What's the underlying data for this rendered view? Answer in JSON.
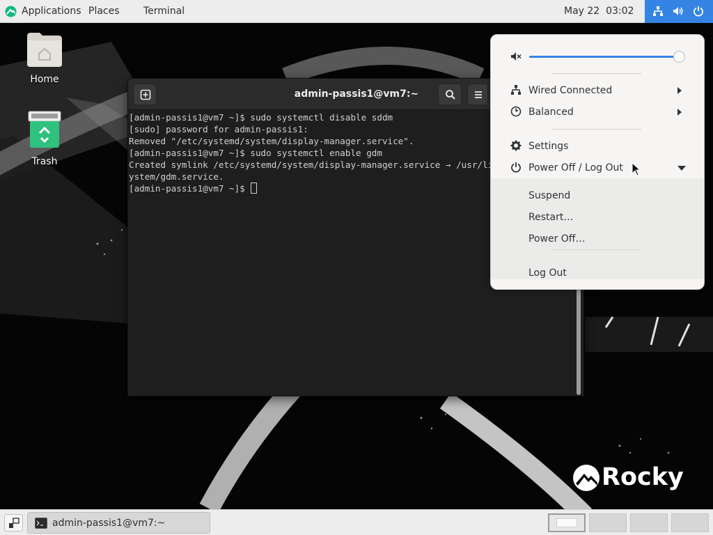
{
  "topbar": {
    "applications": "Applications",
    "places": "Places",
    "terminal": "Terminal",
    "clock": "May 22  03:02",
    "tray_icons": [
      "network-icon",
      "volume-icon",
      "power-icon"
    ]
  },
  "desktop": {
    "icons": [
      {
        "label": "Home",
        "icon": "home-folder-icon"
      },
      {
        "label": "Trash",
        "icon": "trash-icon"
      }
    ],
    "logo_text": "Rocky"
  },
  "terminal": {
    "title": "admin-passis1@vm7:~",
    "lines": [
      "[admin-passis1@vm7 ~]$ sudo systemctl disable sddm",
      "[sudo] password for admin-passis1:",
      "Removed \"/etc/systemd/system/display-manager.service\".",
      "[admin-passis1@vm7 ~]$ sudo systemctl enable gdm",
      "Created symlink /etc/systemd/system/display-manager.service → /usr/lib/s",
      "ystem/gdm.service.",
      "[admin-passis1@vm7 ~]$ "
    ]
  },
  "system_menu": {
    "volume": 0.97,
    "items": [
      {
        "label": "Wired Connected",
        "icon": "network-wired-icon",
        "has_submenu": true
      },
      {
        "label": "Balanced",
        "icon": "power-profile-icon",
        "has_submenu": true
      },
      {
        "label": "Settings",
        "icon": "gear-icon",
        "has_submenu": false
      },
      {
        "label": "Power Off / Log Out",
        "icon": "power-icon",
        "expanded": true
      }
    ],
    "power_submenu": [
      "Suspend",
      "Restart…",
      "Power Off…",
      "Log Out"
    ]
  },
  "bottombar": {
    "task_label": "admin-passis1@vm7:~",
    "workspaces": 4,
    "active_workspace": 1
  },
  "colors": {
    "accent": "#3584e4",
    "panel": "#ededed",
    "terminal_bg": "#1e1e1e",
    "menu_bg": "#f6f5f4"
  }
}
